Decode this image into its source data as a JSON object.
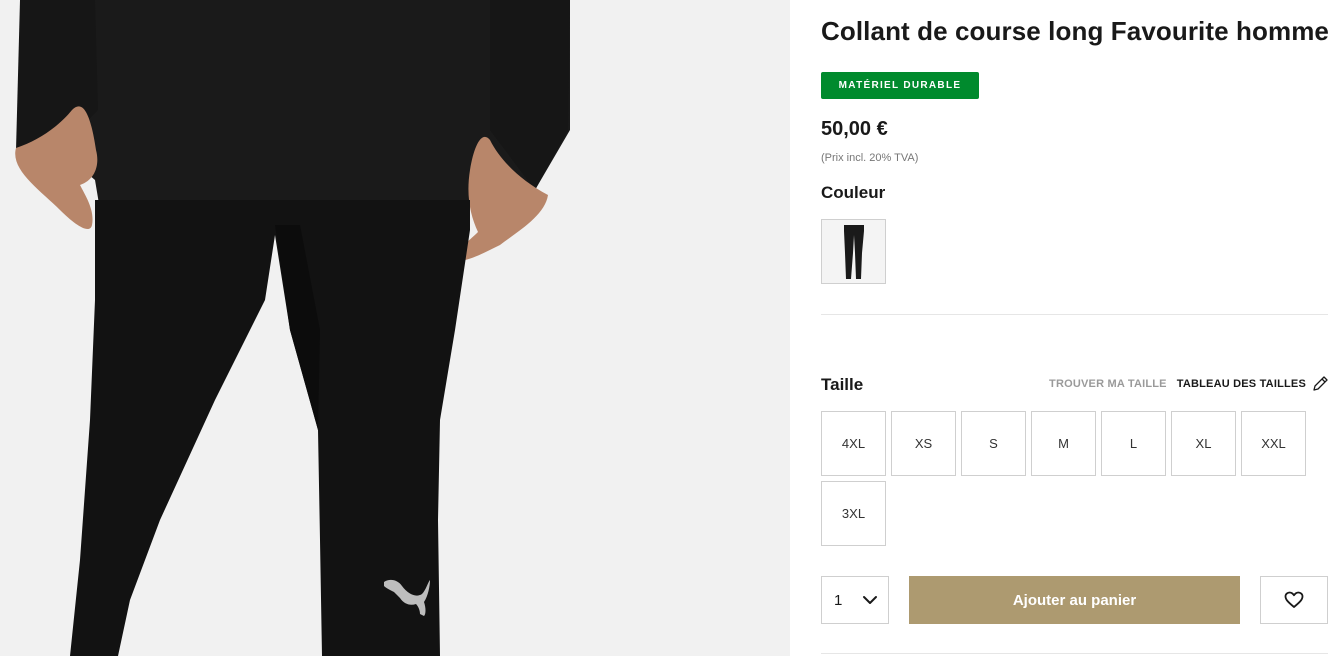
{
  "product": {
    "title": "Collant de course long Favourite homme",
    "badge": "MATÉRIEL DURABLE",
    "price": "50,00 €",
    "tax_note": "(Prix incl. 20% TVA)",
    "image_subject": "black running tights on model",
    "logo_icon": "puma-cat-icon"
  },
  "color": {
    "label": "Couleur",
    "selected_swatch": "black-tights-thumbnail"
  },
  "size": {
    "label": "Taille",
    "find_size": "TROUVER MA TAILLE",
    "size_chart": "TABLEAU DES TAILLES",
    "size_chart_icon": "ruler-pencil-icon",
    "options": [
      "4XL",
      "XS",
      "S",
      "M",
      "L",
      "XL",
      "XXL",
      "3XL"
    ]
  },
  "actions": {
    "quantity": "1",
    "quantity_icon": "chevron-down-icon",
    "add_to_cart": "Ajouter au panier",
    "wishlist_icon": "heart-icon"
  },
  "colors": {
    "badge_green": "#008a2d",
    "cart_gold": "#ad9a70",
    "image_bg": "#f1f1f1"
  }
}
